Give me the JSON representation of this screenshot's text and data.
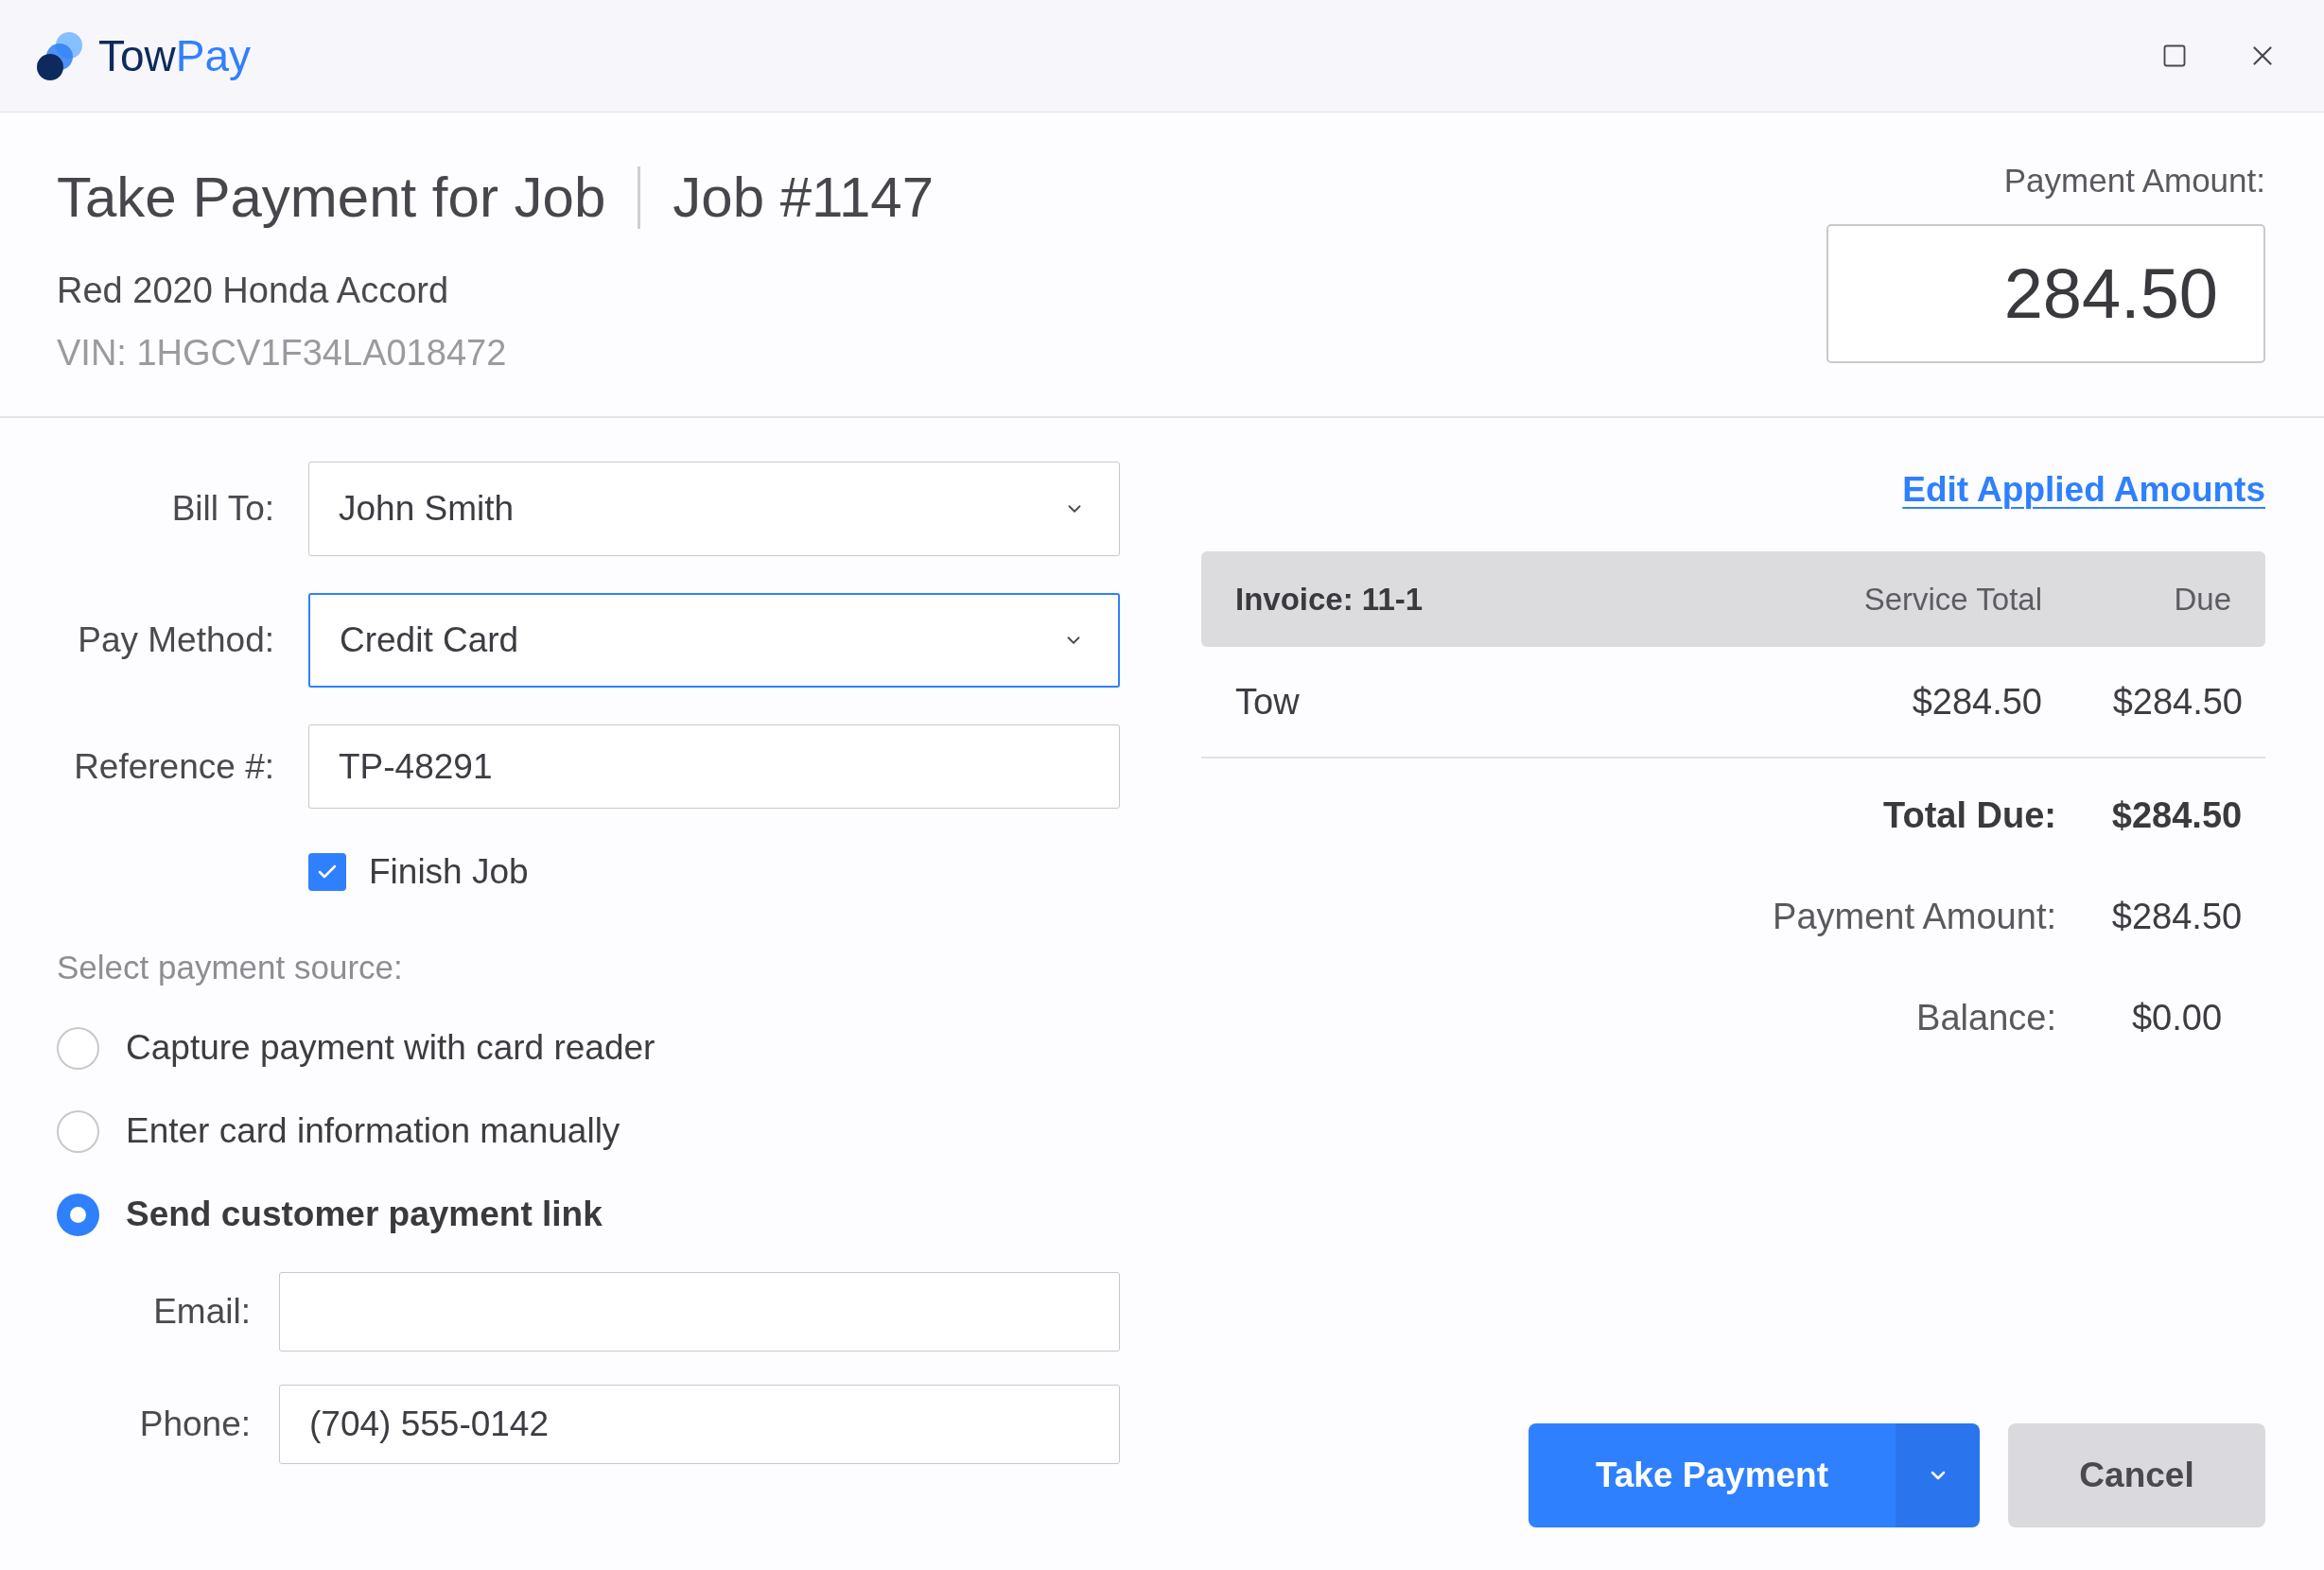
{
  "window": {
    "logo": {
      "name_parts": [
        "Tow",
        "Pay"
      ]
    }
  },
  "header": {
    "title": "Take Payment for Job",
    "job_number": "Job #1147",
    "vehicle": "Red 2020 Honda Accord",
    "vin": "VIN: 1HGCV1F34LA018472",
    "payment_amount": {
      "label": "Payment Amount:",
      "value": "284.50"
    }
  },
  "form": {
    "fields": [
      {
        "kind": "select",
        "label": "Bill To:",
        "value": "John Smith",
        "focused": false
      },
      {
        "kind": "select",
        "label": "Pay Method:",
        "value": "Credit Card",
        "focused": true
      },
      {
        "kind": "text",
        "label": "Reference #:",
        "value": "TP-48291",
        "focused": false
      }
    ],
    "finish_job": {
      "label": "Finish Job",
      "checked": true
    },
    "source_prompt": "Select payment source:",
    "sources": [
      {
        "label": "Capture payment with card reader",
        "selected": false
      },
      {
        "label": "Enter card information manually",
        "selected": false
      },
      {
        "label": "Send customer payment link",
        "selected": true
      }
    ],
    "contact_fields": [
      {
        "label": "Email:"
      },
      {
        "label": "Phone:",
        "value": "(704) 555-0142"
      }
    ]
  },
  "invoice": {
    "link": "Edit Applied Amounts",
    "columns": [
      "Invoice: 11-1",
      "Service Total",
      "Due"
    ],
    "rows": [
      {
        "item": "Tow",
        "service_total": "$284.50",
        "due": "$284.50"
      }
    ],
    "summary": [
      {
        "label": "Total Due:",
        "value": "$284.50",
        "emphasis": true
      },
      {
        "label": "Payment Amount:",
        "value": "$284.50",
        "emphasis": false
      },
      {
        "label": "Balance:",
        "value": "$0.00",
        "emphasis": false
      }
    ]
  },
  "actions": {
    "primary": "Take Payment",
    "cancel": "Cancel"
  }
}
